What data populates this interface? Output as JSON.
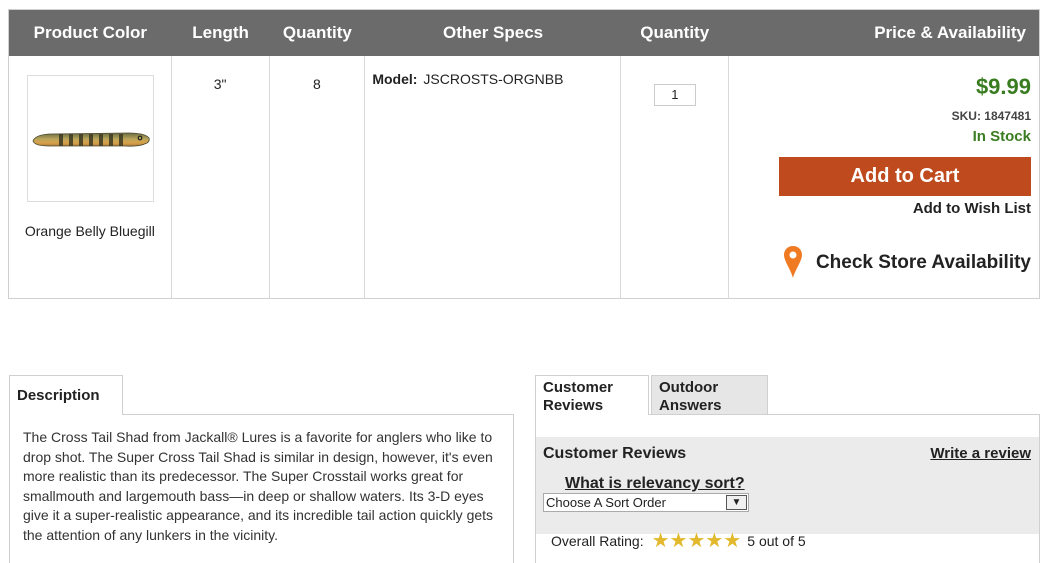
{
  "table": {
    "headers": [
      "Product Color",
      "Length",
      "Quantity",
      "Other Specs",
      "Quantity",
      "Price & Availability"
    ],
    "row": {
      "color_name": "Orange Belly Bluegill",
      "length": "3\"",
      "quantity": "8",
      "model_label": "Model:",
      "model_value": "JSCROSTS-ORGNBB",
      "qty_value": "1",
      "price": "$9.99",
      "sku": "SKU: 1847481",
      "stock": "In Stock",
      "add_to_cart": "Add to Cart",
      "add_to_wishlist": "Add to Wish List",
      "check_store": "Check Store Availability"
    }
  },
  "description": {
    "tab_label": "Description",
    "text": "The Cross Tail Shad from Jackall® Lures is a favorite for anglers who like to drop shot. The Super Cross Tail Shad is similar in design, however, it's even more realistic than its predecessor. The Super Crosstail works great for smallmouth and largemouth bass—in deep or shallow waters. Its 3-D eyes give it a super-realistic appearance, and its incredible tail action quickly gets the attention of any lunkers in the vicinity."
  },
  "reviews": {
    "tabs": [
      "Customer Reviews",
      "Outdoor Answers"
    ],
    "title": "Customer Reviews",
    "write_link": "Write a review",
    "relevancy_link": "What is relevancy sort?",
    "sort_selected": "Choose A Sort Order",
    "overall_label": "Overall Rating:",
    "rating": 5,
    "rating_text": "5 out of 5"
  },
  "colors": {
    "header_bg": "#6b6b6b",
    "price_green": "#3a7d21",
    "cart_orange": "#be4a1e",
    "pin_orange": "#f07a22",
    "star_gold": "#e2b92c"
  },
  "icons": {
    "store_pin": "map-pin-icon",
    "sort_arrow": "chevron-down-icon",
    "star": "star-icon"
  }
}
